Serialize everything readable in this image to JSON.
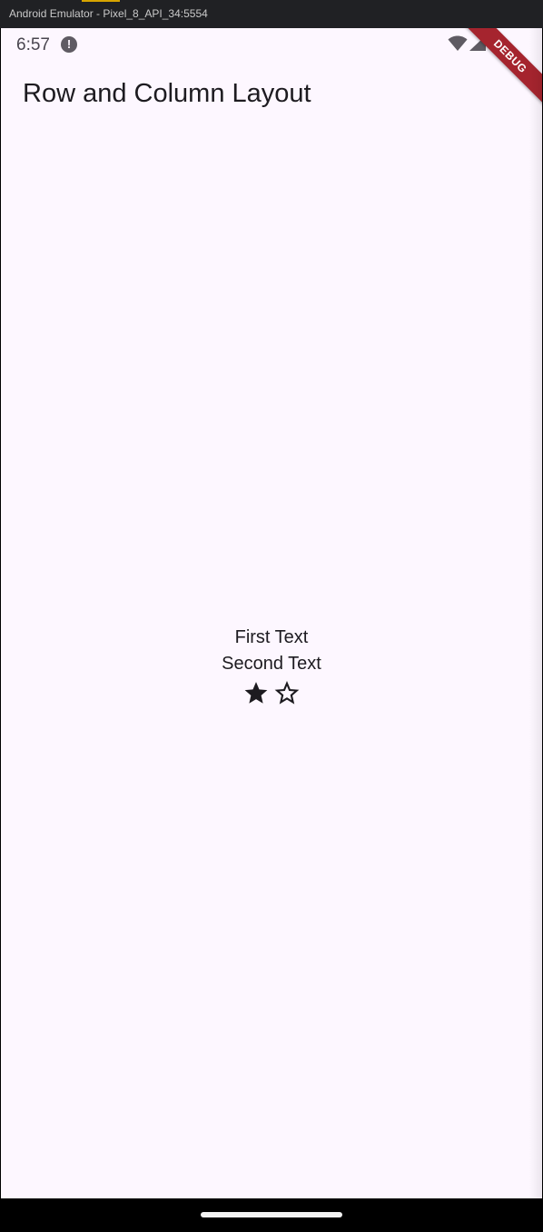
{
  "window": {
    "title": "Android Emulator - Pixel_8_API_34:5554"
  },
  "status_bar": {
    "time": "6:57",
    "alert_glyph": "!",
    "icons": [
      "alert-icon",
      "wifi-icon",
      "signal-icon"
    ]
  },
  "debug_banner": {
    "label": "DEBUG",
    "color": "#a5242e"
  },
  "app_bar": {
    "title": "Row and Column Layout"
  },
  "body": {
    "first_text": "First Text",
    "second_text": "Second Text",
    "icons": [
      "star-filled-icon",
      "star-outline-icon"
    ]
  },
  "colors": {
    "background": "#fdf7ff",
    "text": "#1d1b20",
    "titlebar": "#202124"
  }
}
